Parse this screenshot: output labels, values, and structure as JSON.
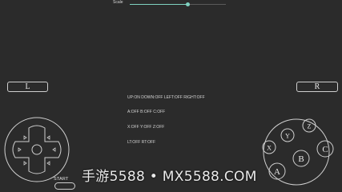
{
  "scale": {
    "label": "Scale",
    "value": 0.6
  },
  "shoulders": {
    "left_label": "L",
    "right_label": "R"
  },
  "status_lines": [
    "UP:ON DOWN:OFF LEFT:OFF RIGHT:OFF",
    "A:OFF B:OFF C:OFF",
    "X:OFF Y:OFF Z:OFF",
    "LT:OFF RT:OFF"
  ],
  "start": {
    "label": "START"
  },
  "face_buttons": {
    "x": "X",
    "y": "Y",
    "z": "Z",
    "a": "A",
    "b": "B",
    "c": "C"
  },
  "watermark": {
    "text": "手游5588 • MX5588.COM"
  },
  "colors": {
    "background": "#2b2b2b",
    "accent": "#7fd1c0",
    "outline": "#cfcfcf"
  }
}
